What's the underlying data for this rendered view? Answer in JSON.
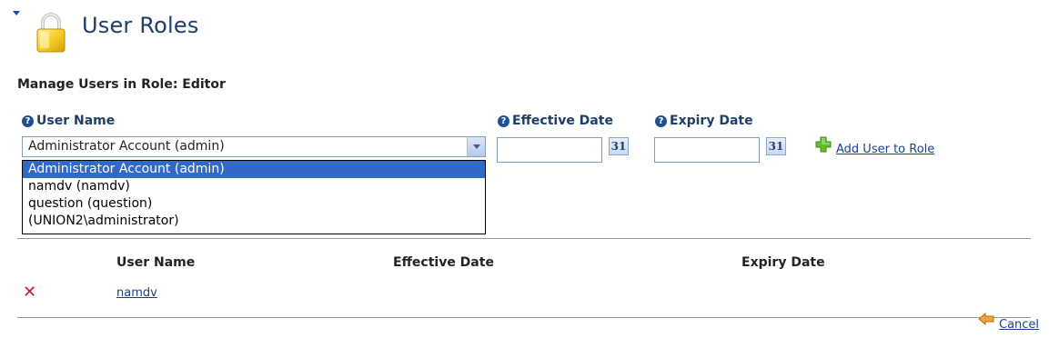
{
  "header": {
    "title": "User Roles"
  },
  "form": {
    "subtitle": "Manage Users in Role: Editor",
    "user_name_label": "User Name",
    "effective_date_label": "Effective Date",
    "expiry_date_label": "Expiry Date",
    "selected_user": "Administrator Account (admin)",
    "user_options": [
      "Administrator Account (admin)",
      "namdv (namdv)",
      "question (question)",
      "(UNION2\\administrator)"
    ],
    "effective_date_value": "",
    "expiry_date_value": "",
    "calendar_label": "31",
    "add_link": "Add User to Role"
  },
  "table": {
    "headers": [
      "User Name",
      "Effective Date",
      "Expiry Date"
    ],
    "rows": [
      {
        "user": "namdv",
        "effective": "",
        "expiry": ""
      }
    ]
  },
  "footer": {
    "cancel_label": "Cancel"
  },
  "icons": {
    "collapse": "collapse-triangle-icon",
    "lock": "lock-icon",
    "help": "help-icon",
    "calendar": "calendar-icon",
    "add": "plus-icon",
    "delete": "delete-x-icon",
    "cancel": "arrow-left-icon"
  },
  "colors": {
    "title": "#1f3d6b",
    "link": "#1a3f8a",
    "selection": "#3169c6",
    "delete": "#cc1a1a"
  }
}
